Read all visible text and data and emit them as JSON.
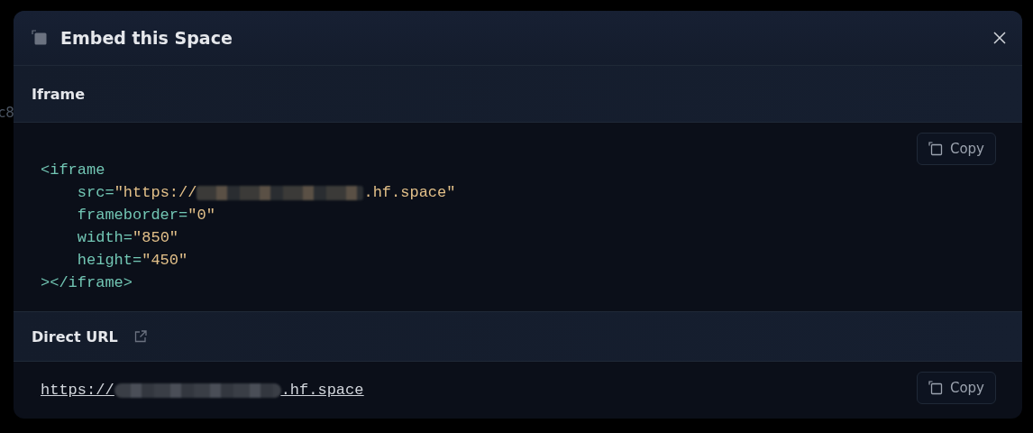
{
  "background_fragments": [
    "c8"
  ],
  "dialog": {
    "title": "Embed this Space",
    "sections": [
      {
        "kind": "code",
        "title": "Iframe",
        "copy_label": "Copy",
        "lines": [
          [
            {
              "kind": "tag",
              "text": "<iframe"
            }
          ],
          [
            {
              "kind": "attr",
              "text": "    src="
            },
            {
              "kind": "string",
              "text": "\"https://"
            },
            {
              "kind": "redacted"
            },
            {
              "kind": "string",
              "text": ".hf.space\""
            }
          ],
          [
            {
              "kind": "attr",
              "text": "    frameborder="
            },
            {
              "kind": "string",
              "text": "\"0\""
            }
          ],
          [
            {
              "kind": "attr",
              "text": "    width="
            },
            {
              "kind": "string",
              "text": "\"850\""
            }
          ],
          [
            {
              "kind": "attr",
              "text": "    height="
            },
            {
              "kind": "string",
              "text": "\"450\""
            }
          ],
          [
            {
              "kind": "tag",
              "text": "></iframe>"
            }
          ]
        ]
      },
      {
        "kind": "link",
        "title": "Direct URL",
        "copy_label": "Copy",
        "url_start": "https://",
        "url_end": ".hf.space"
      }
    ]
  }
}
